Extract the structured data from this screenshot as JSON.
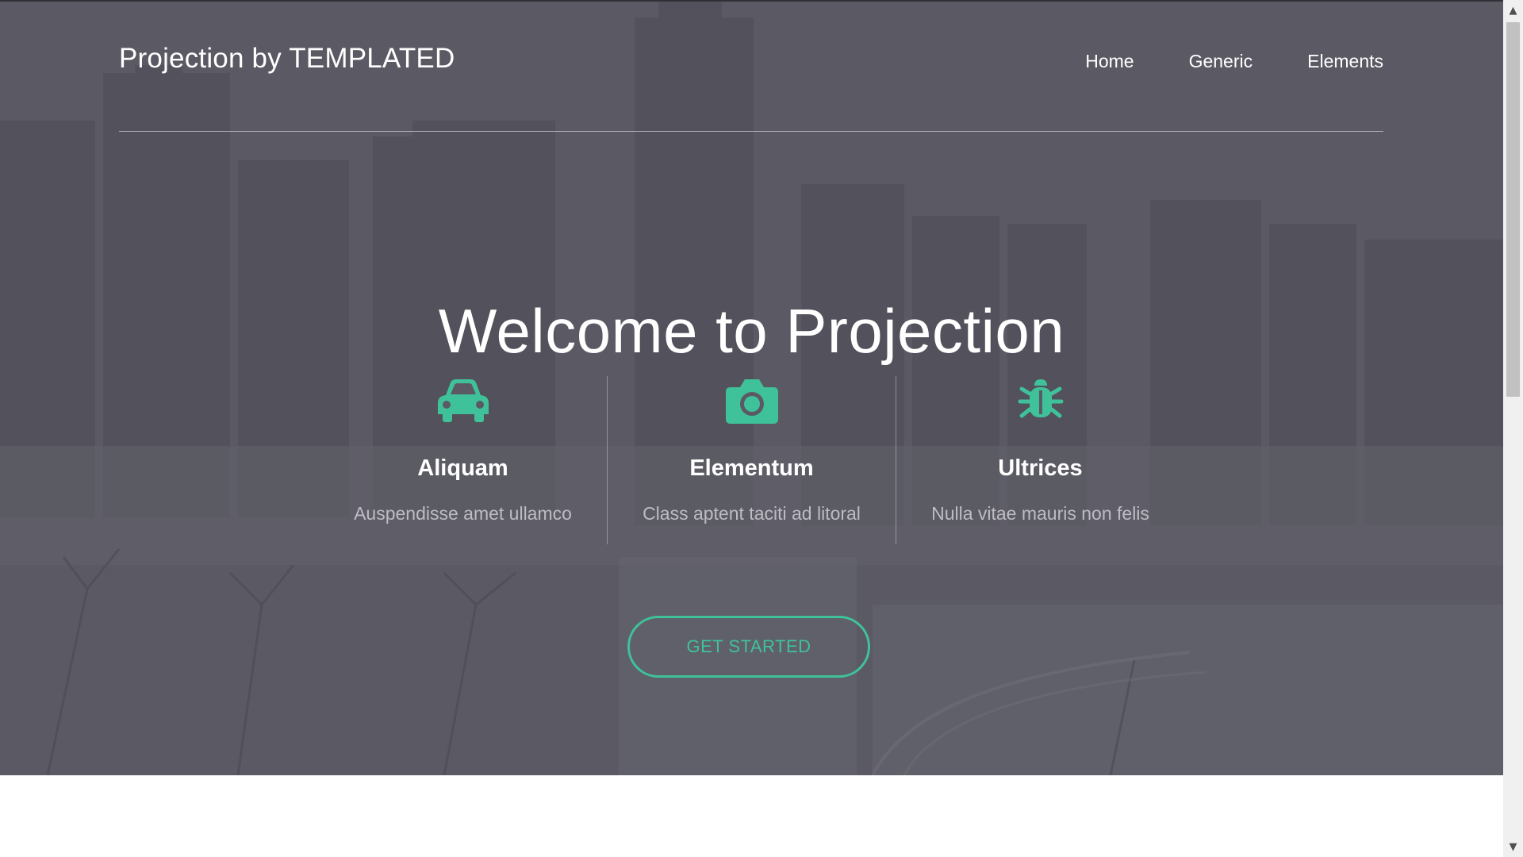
{
  "header": {
    "logo": "Projection by TEMPLATED",
    "nav": [
      {
        "label": "Home"
      },
      {
        "label": "Generic"
      },
      {
        "label": "Elements"
      }
    ]
  },
  "hero": {
    "title": "Welcome to Projection",
    "features": [
      {
        "icon": "car-icon",
        "title": "Aliquam",
        "text": "Auspendisse amet ullamco"
      },
      {
        "icon": "camera-icon",
        "title": "Elementum",
        "text": "Class aptent taciti ad litoral"
      },
      {
        "icon": "bug-icon",
        "title": "Ultrices",
        "text": "Nulla vitae mauris non felis"
      }
    ],
    "cta_label": "GET STARTED"
  },
  "colors": {
    "accent": "#3fc29a",
    "overlay": "#5a5963"
  },
  "scrollbar": {
    "up_icon": "chevron-up-icon",
    "down_icon": "chevron-down-icon"
  }
}
